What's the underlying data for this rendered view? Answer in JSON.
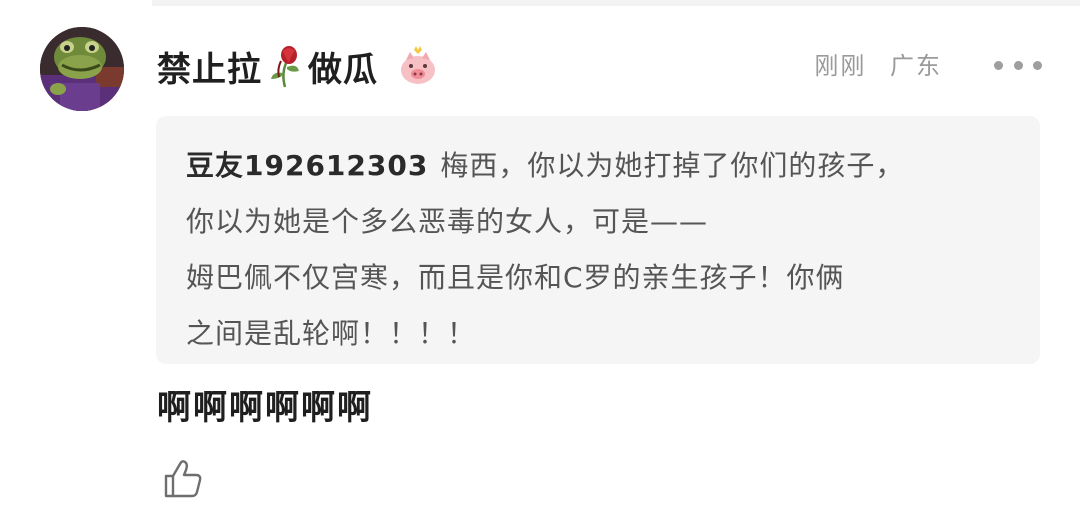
{
  "comment": {
    "avatar_icon": "frog-avatar",
    "username": {
      "part1": "禁止拉",
      "part2": "做瓜"
    },
    "username_emoji_icon": "wilted-rose-icon",
    "badge_icon": "pig-badge-icon",
    "time": "刚刚",
    "location": "广东",
    "more_icon": "more-dots-icon",
    "quote": {
      "author": "豆友192612303",
      "lines": [
        "梅西，你以为她打掉了你们的孩子，",
        "你以为她是个多么恶毒的女人，可是——",
        "姆巴佩不仅宫寒，而且是你和C罗的亲生孩子！你俩",
        "之间是乱轮啊！！！！"
      ]
    },
    "reply": "啊啊啊啊啊啊",
    "like_icon": "thumbs-up-icon"
  },
  "colors": {
    "text_primary": "#1f1f1f",
    "text_secondary": "#555555",
    "meta": "#9a9a9a",
    "quote_bg": "#f5f5f5"
  }
}
